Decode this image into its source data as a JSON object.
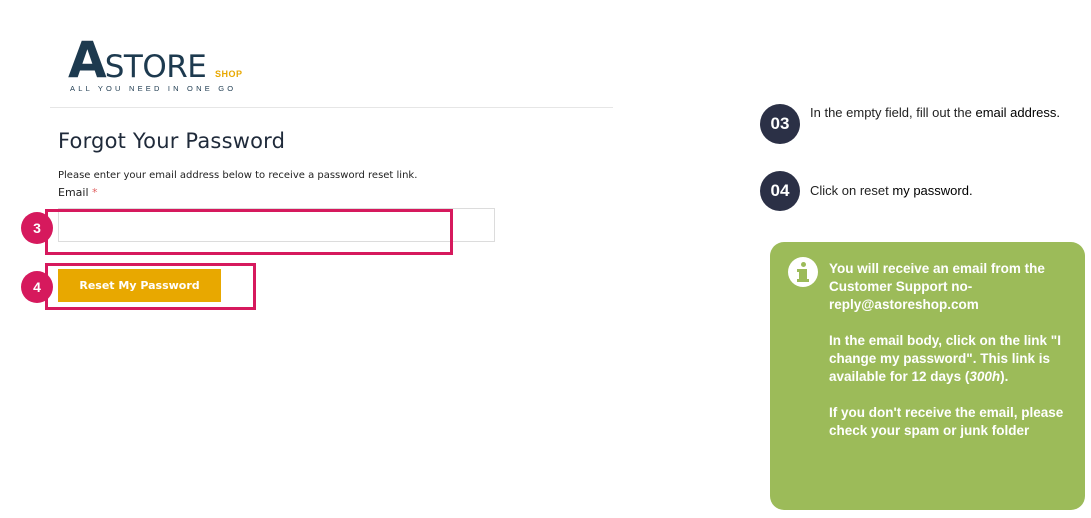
{
  "logo": {
    "letter": "A",
    "rest": "STORE",
    "shop": "SHOP",
    "tagline": "ALL YOU NEED IN ONE GO"
  },
  "form": {
    "title": "Forgot Your Password",
    "instructions": "Please enter your email address below to receive a password reset link.",
    "email_label": "Email",
    "required_mark": "*",
    "email_value": "",
    "reset_label": "Reset My Password"
  },
  "markers": {
    "m3": "3",
    "m4": "4"
  },
  "steps": [
    {
      "number": "03",
      "text_plain": "In the empty field, fill out the ",
      "text_bold": "email address."
    },
    {
      "number": "04",
      "text_plain": "Click on reset ",
      "text_bold": "my password."
    }
  ],
  "info": {
    "p1": "You will receive an email from the  Customer Support no-reply@astoreshop.com",
    "p2": "In the email body, click on the link \"I change my password\". This link is available for 12 days (",
    "p2_italic": "300h",
    "p2_end": ").",
    "p3": "If you don't receive the email, please check your spam or junk folder"
  },
  "colors": {
    "highlight": "#d6195d",
    "button": "#e8a800",
    "info_box": "#9cbb59",
    "step_badge": "#2b3046",
    "brand_navy": "#1d3a4f"
  }
}
